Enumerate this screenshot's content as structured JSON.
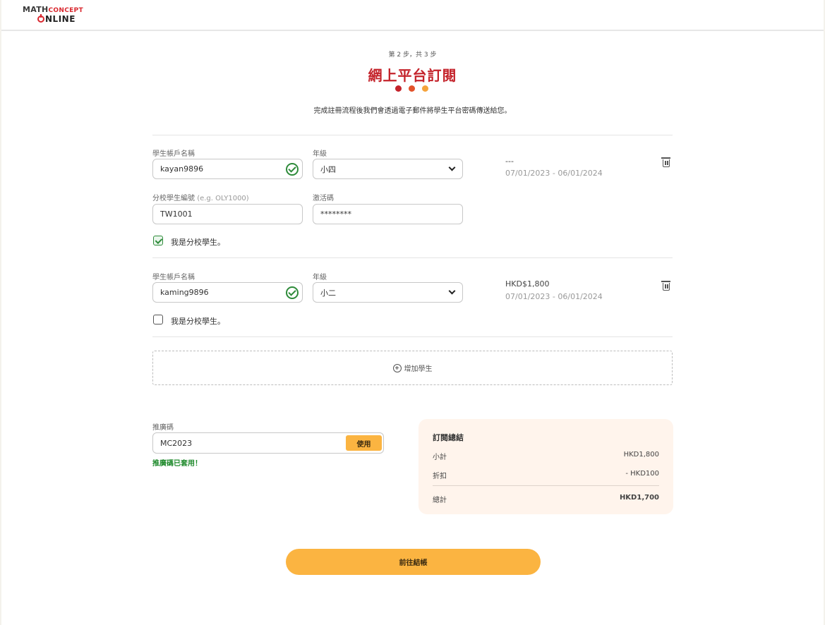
{
  "logo": {
    "top_part1": "MATH",
    "top_part2": "CONCEPT",
    "bottom": "NLINE"
  },
  "step": "第 2 步，共 3 步",
  "title": "網上平台訂閱",
  "progress_dots": [
    "#c4232b",
    "#e2522a",
    "#f5a33b"
  ],
  "subtitle": "完成註冊流程後我們會透過電子郵件將學生平台密碼傳送給您。",
  "students": [
    {
      "account_label": "學生帳戶名稱",
      "account_value": "kayan9896",
      "grade_label": "年級",
      "grade_value": "小四",
      "school_id_label": "分校學生編號",
      "school_id_hint": "(e.g. OLY1000)",
      "school_id_value": "TW1001",
      "activation_label": "激活碼",
      "activation_value": "********",
      "price": "---",
      "period": "07/01/2023 - 06/01/2024",
      "branch_checkbox_label": "我是分校學生。",
      "branch_checked": true
    },
    {
      "account_label": "學生帳戶名稱",
      "account_value": "kaming9896",
      "grade_label": "年級",
      "grade_value": "小二",
      "price": "HKD$1,800",
      "period": "07/01/2023 - 06/01/2024",
      "branch_checkbox_label": "我是分校學生。",
      "branch_checked": false
    }
  ],
  "add_student_label": "增加學生",
  "promo": {
    "label": "推廣碼",
    "value": "MC2023",
    "apply_label": "使用",
    "success_message": "推廣碼已套用！"
  },
  "summary": {
    "title": "訂閱總結",
    "subtotal_label": "小計",
    "subtotal_value": "HKD1,800",
    "discount_label": "折扣",
    "discount_value": "- HKD100",
    "total_label": "總計",
    "total_value": "HKD1,700"
  },
  "checkout_label": "前往結帳",
  "colors": {
    "brand_red": "#c4232b",
    "accent_orange": "#fbb441",
    "success_green": "#2e8b3a",
    "summary_bg": "#fff4ec"
  }
}
